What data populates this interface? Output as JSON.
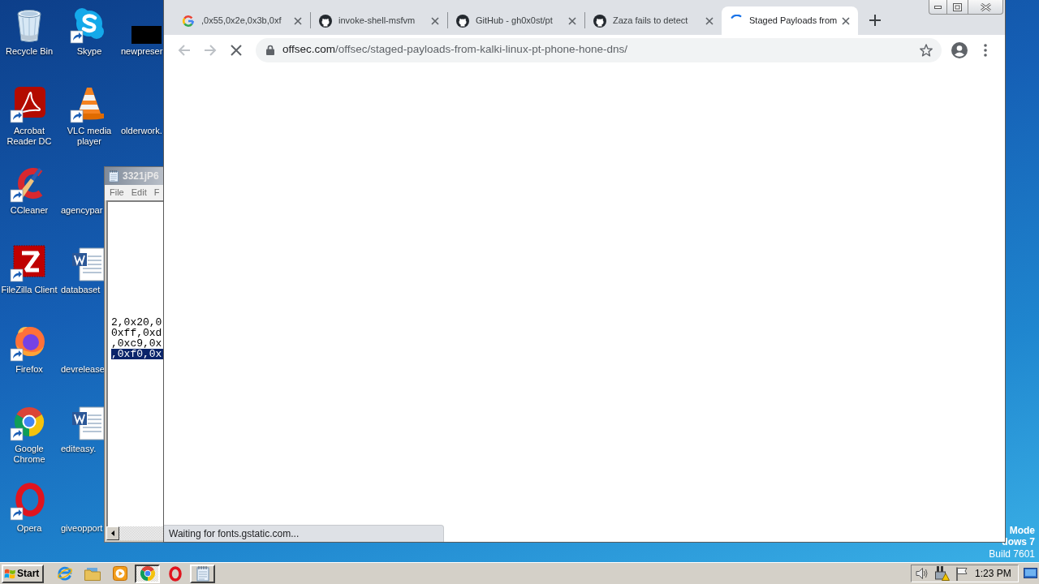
{
  "desktop": {
    "icons": [
      {
        "kind": "recycle-bin",
        "label": "Recycle Bin",
        "shortcut": false
      },
      {
        "kind": "acrobat",
        "label": "Acrobat Reader DC",
        "shortcut": true
      },
      {
        "kind": "ccleaner",
        "label": "CCleaner",
        "shortcut": true
      },
      {
        "kind": "filezilla",
        "label": "FileZilla Client",
        "shortcut": true
      },
      {
        "kind": "firefox",
        "label": "Firefox",
        "shortcut": true
      },
      {
        "kind": "chrome",
        "label": "Google Chrome",
        "shortcut": true
      },
      {
        "kind": "opera",
        "label": "Opera",
        "shortcut": true
      },
      {
        "kind": "skype",
        "label": "Skype",
        "shortcut": true
      },
      {
        "kind": "vlc",
        "label": "VLC media player",
        "shortcut": true
      },
      {
        "kind": "blank",
        "label": "agencypar"
      },
      {
        "kind": "word",
        "label": "databaset",
        "shortcut": false
      },
      {
        "kind": "blank",
        "label": "devrelease"
      },
      {
        "kind": "word",
        "label": "editeasy.",
        "shortcut": false
      },
      {
        "kind": "blank",
        "label": "giveopport"
      },
      {
        "kind": "dark-image",
        "label": "newpreser"
      },
      {
        "kind": "blank",
        "label": "olderwork."
      }
    ],
    "corner_text": [
      {
        "text": "Mode",
        "kind": "bold"
      },
      {
        "text": "dows 7",
        "kind": "bold"
      },
      {
        "text": "Build 7601",
        "kind": "plain"
      }
    ]
  },
  "notepad": {
    "title": "3321jP6",
    "menu": [
      "File",
      "Edit",
      "F"
    ],
    "lines": [
      {
        "text": "2,0x20,0",
        "selected": false
      },
      {
        "text": "0xff,0xd",
        "selected": false
      },
      {
        "text": ",0xc9,0x",
        "selected": false
      },
      {
        "text": ",0xf0,0x",
        "selected": true
      }
    ]
  },
  "browser": {
    "tabs": [
      {
        "kind": "google",
        "title": ",0x55,0x2e,0x3b,0xf",
        "selected": false
      },
      {
        "kind": "github",
        "title": "invoke-shell-msfvm",
        "selected": false
      },
      {
        "kind": "github",
        "title": "GitHub - gh0x0st/pt",
        "selected": false
      },
      {
        "kind": "github",
        "title": "Zaza fails to detect",
        "selected": false
      },
      {
        "kind": "loading",
        "title": "Staged Payloads from",
        "selected": true
      }
    ],
    "nav_buttons": [
      {
        "kind": "back",
        "disabled": true
      },
      {
        "kind": "forward",
        "disabled": true
      },
      {
        "kind": "stop",
        "disabled": false
      }
    ],
    "address": {
      "secure": true,
      "host": "offsec.com",
      "path": "/offsec/staged-payloads-from-kalki-linux-pt-phone-hone-dns/"
    },
    "starred": false,
    "status": "Waiting for fonts.gstatic.com..."
  },
  "taskbar": {
    "start": "Start",
    "items": [
      {
        "kind": "ie",
        "open": false,
        "selected": false
      },
      {
        "kind": "explorer",
        "open": false,
        "selected": false
      },
      {
        "kind": "media-player",
        "open": false,
        "selected": false
      },
      {
        "kind": "chrome",
        "open": true,
        "selected": true
      },
      {
        "kind": "opera",
        "open": false,
        "selected": false
      },
      {
        "kind": "notepad",
        "open": true,
        "selected": false
      }
    ],
    "clock": "1:23 PM"
  }
}
